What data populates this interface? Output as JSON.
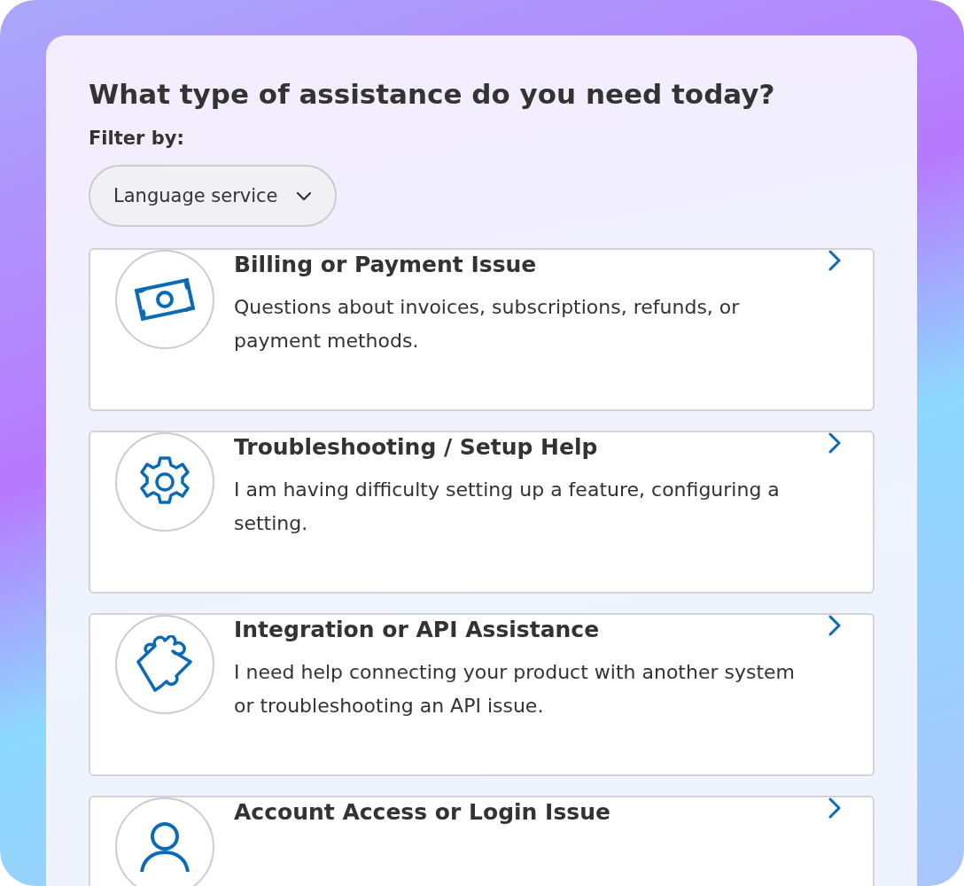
{
  "heading": "What type of assistance do you need today?",
  "filter": {
    "label": "Filter by:",
    "value": "Language service"
  },
  "options": [
    {
      "title": "Billing or Payment Issue",
      "description": "Questions about invoices, subscriptions, refunds, or payment methods."
    },
    {
      "title": "Troubleshooting / Setup Help",
      "description": "I am having difficulty setting up a feature, configuring a setting."
    },
    {
      "title": "Integration or API Assistance",
      "description": "I need help connecting your product with another system or troubleshooting an API issue."
    },
    {
      "title": "Account Access or Login Issue"
    }
  ]
}
